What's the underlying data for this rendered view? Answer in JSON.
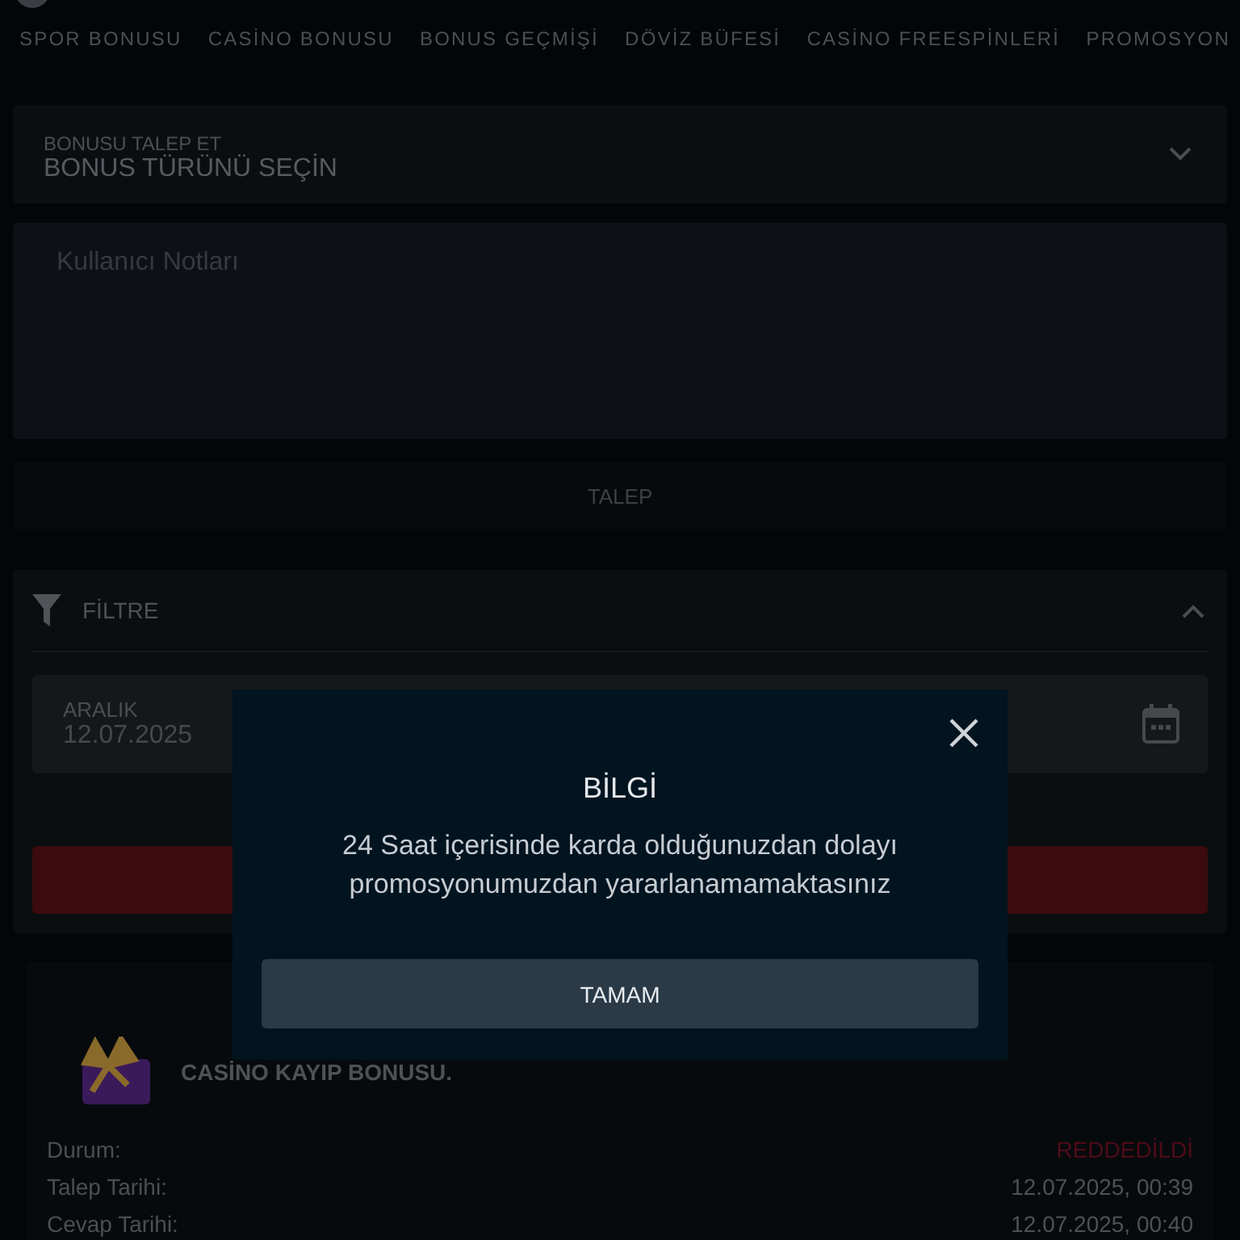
{
  "tabs": [
    {
      "label": "SPOR BONUSU",
      "selected": false
    },
    {
      "label": "CASİNO BONUSU",
      "selected": false
    },
    {
      "label": "BONUS GEÇMİŞİ",
      "selected": false
    },
    {
      "label": "DÖVİZ BÜFESİ",
      "selected": false
    },
    {
      "label": "CASİNO FREESPİNLERİ",
      "selected": false
    },
    {
      "label": "PROMOSYON",
      "selected": false
    }
  ],
  "bonus_select": {
    "label": "BONUSU TALEP ET",
    "value": "BONUS TÜRÜNÜ SEÇİN"
  },
  "notes": {
    "placeholder": "Kullanıcı Notları"
  },
  "request_button": {
    "label": "TALEP",
    "disabled": true
  },
  "filter": {
    "title": "FİLTRE",
    "expanded": true,
    "date_field": {
      "label": "ARALIK",
      "value": "12.07.2025"
    }
  },
  "bonus_card": {
    "title": "CASİNO KAYIP BONUSU.",
    "rows": [
      {
        "kind": "status",
        "label": "Durum:",
        "value": "REDDEDİLDİ"
      },
      {
        "kind": "plain",
        "label": "Talep Tarihi:",
        "value": "12.07.2025, 00:39"
      },
      {
        "kind": "plain",
        "label": "Cevap Tarihi:",
        "value": "12.07.2025, 00:40"
      }
    ]
  },
  "dialog": {
    "title": "BİLGİ",
    "message": "24 Saat içerisinde karda olduğunuzdan dolayı promosyonumuzdan yararlanamamaktasınız",
    "button": "TAMAM"
  }
}
